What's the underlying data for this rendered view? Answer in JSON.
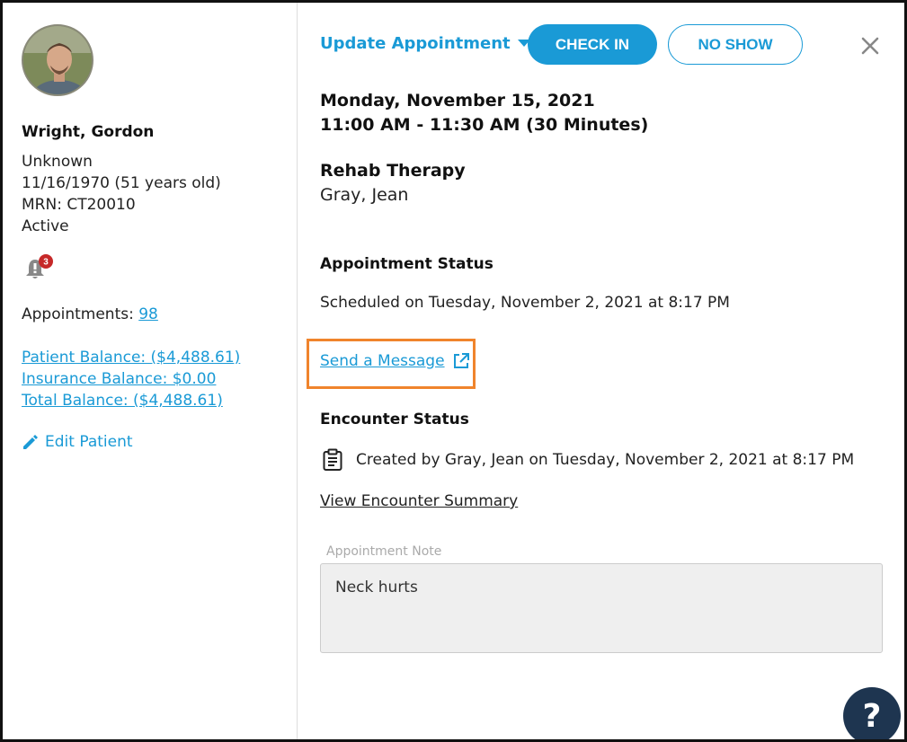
{
  "patient": {
    "name": "Wright, Gordon",
    "gender": "Unknown",
    "dob": "11/16/1970 (51 years old)",
    "mrn": "MRN: CT20010",
    "status": "Active",
    "alert_count": "3",
    "appointments_label": "Appointments: ",
    "appointments_count": "98",
    "patient_balance": "Patient Balance: ($4,488.61)",
    "insurance_balance": "Insurance Balance: $0.00",
    "total_balance": "Total Balance: ($4,488.61)",
    "edit_label": "Edit Patient"
  },
  "toolbar": {
    "update_label": "Update Appointment",
    "check_in_label": "CHECK IN",
    "no_show_label": "NO SHOW"
  },
  "appointment": {
    "date": "Monday, November 15, 2021",
    "time": "11:00 AM - 11:30 AM (30 Minutes)",
    "service": "Rehab Therapy",
    "provider": "Gray, Jean",
    "status_heading": "Appointment Status",
    "status_text": "Scheduled on Tuesday, November 2, 2021 at 8:17 PM",
    "send_message": "Send a Message",
    "encounter_heading": "Encounter Status",
    "encounter_text": "Created by Gray, Jean on Tuesday, November 2, 2021 at 8:17 PM",
    "view_summary": "View Encounter Summary",
    "note_label": "Appointment Note",
    "note_value": "Neck hurts"
  },
  "help_label": "?",
  "colors": {
    "accent": "#1a9ad6",
    "highlight": "#f0842c",
    "badge": "#c62828",
    "help_bg": "#1e3550"
  }
}
